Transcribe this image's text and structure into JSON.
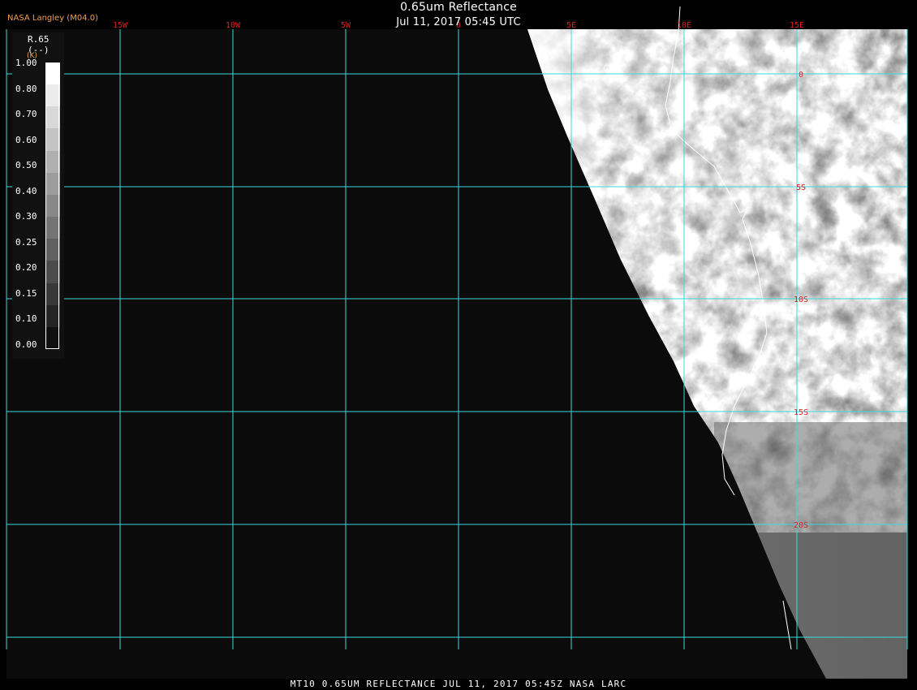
{
  "header": {
    "title": "0.65um Reflectance",
    "subtitle": "Jul 11, 2017 05:45 UTC",
    "producer": "NASA Langley (M04.0)"
  },
  "footer": {
    "banner": "MT10  0.65UM REFLECTANCE   JUL 11, 2017 05:45Z   NASA LARC"
  },
  "legend": {
    "name": "R.65",
    "unit": "(--)",
    "flag": "(K)",
    "ticks": [
      "1.00",
      "0.80",
      "0.70",
      "0.60",
      "0.50",
      "0.40",
      "0.30",
      "0.25",
      "0.20",
      "0.15",
      "0.10",
      "0.00"
    ],
    "swatch_colors": [
      "#ffffff",
      "#ececec",
      "#d8d8d8",
      "#c4c4c4",
      "#b0b0b0",
      "#9c9c9c",
      "#888888",
      "#747474",
      "#606060",
      "#4c4c4c",
      "#383838",
      "#242424",
      "#101010"
    ]
  },
  "map": {
    "grid_color": "#3ad8e0",
    "label_color": "#e02020",
    "ocean_color": "#0b0b0b",
    "coast_color": "#ffffff",
    "longitude_labels": [
      "15W",
      "10W",
      "5W",
      "0",
      "5E",
      "10E",
      "15E"
    ],
    "latitude_labels": [
      "0",
      "5S",
      "10S",
      "15S",
      "20S"
    ]
  }
}
